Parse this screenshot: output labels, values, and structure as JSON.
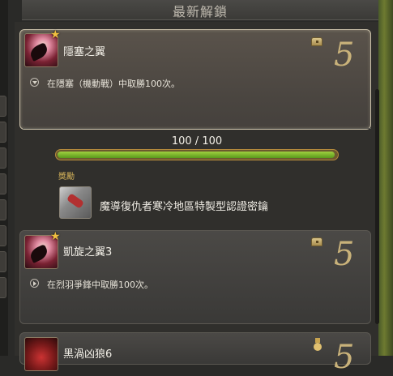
{
  "header": {
    "title": "最新解鎖"
  },
  "achievements": [
    {
      "title": "隱塞之翼",
      "description": "在隱塞（機動戰）中取勝100次。",
      "points": "5",
      "progress": {
        "current": 100,
        "max": 100,
        "text": "100 / 100"
      },
      "reward_label": "獎勵",
      "reward_name": "魔導復仇者寒冷地區特製型認證密鑰"
    },
    {
      "title": "凱旋之翼3",
      "description": "在烈羽爭鋒中取勝100次。",
      "points": "5"
    },
    {
      "title": "黑渦凶狼6",
      "points": "5"
    }
  ],
  "icons": {
    "achievement": "wing-icon",
    "favorite": "star-icon",
    "reward_type": "treasure-chest-icon",
    "reward_type_3": "medal-icon"
  },
  "colors": {
    "accent_gold": "#c9b27a",
    "progress_green": "#7fb82e"
  }
}
